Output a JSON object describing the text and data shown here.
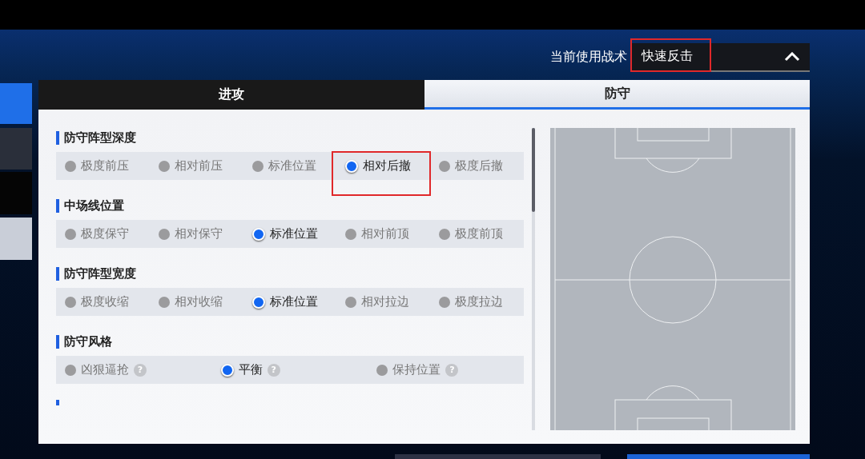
{
  "tactic": {
    "label": "当前使用战术",
    "value": "快速反击"
  },
  "tabs": [
    {
      "label": "进攻",
      "selected": false
    },
    {
      "label": "防守",
      "selected": true
    }
  ],
  "sections": [
    {
      "title": "防守阵型深度",
      "options": [
        {
          "label": "极度前压",
          "selected": false
        },
        {
          "label": "相对前压",
          "selected": false
        },
        {
          "label": "标准位置",
          "selected": false
        },
        {
          "label": "相对后撤",
          "selected": true,
          "highlighted": true
        },
        {
          "label": "极度后撤",
          "selected": false
        }
      ]
    },
    {
      "title": "中场线位置",
      "options": [
        {
          "label": "极度保守",
          "selected": false
        },
        {
          "label": "相对保守",
          "selected": false
        },
        {
          "label": "标准位置",
          "selected": true
        },
        {
          "label": "相对前顶",
          "selected": false
        },
        {
          "label": "极度前顶",
          "selected": false
        }
      ]
    },
    {
      "title": "防守阵型宽度",
      "options": [
        {
          "label": "极度收缩",
          "selected": false
        },
        {
          "label": "相对收缩",
          "selected": false
        },
        {
          "label": "标准位置",
          "selected": true
        },
        {
          "label": "相对拉边",
          "selected": false
        },
        {
          "label": "极度拉边",
          "selected": false
        }
      ]
    },
    {
      "title": "防守风格",
      "options": [
        {
          "label": "凶狠逼抢",
          "selected": false,
          "help": "?"
        },
        {
          "label": "平衡",
          "selected": true,
          "help": "?"
        },
        {
          "label": "保持位置",
          "selected": false,
          "help": "?"
        }
      ]
    }
  ]
}
